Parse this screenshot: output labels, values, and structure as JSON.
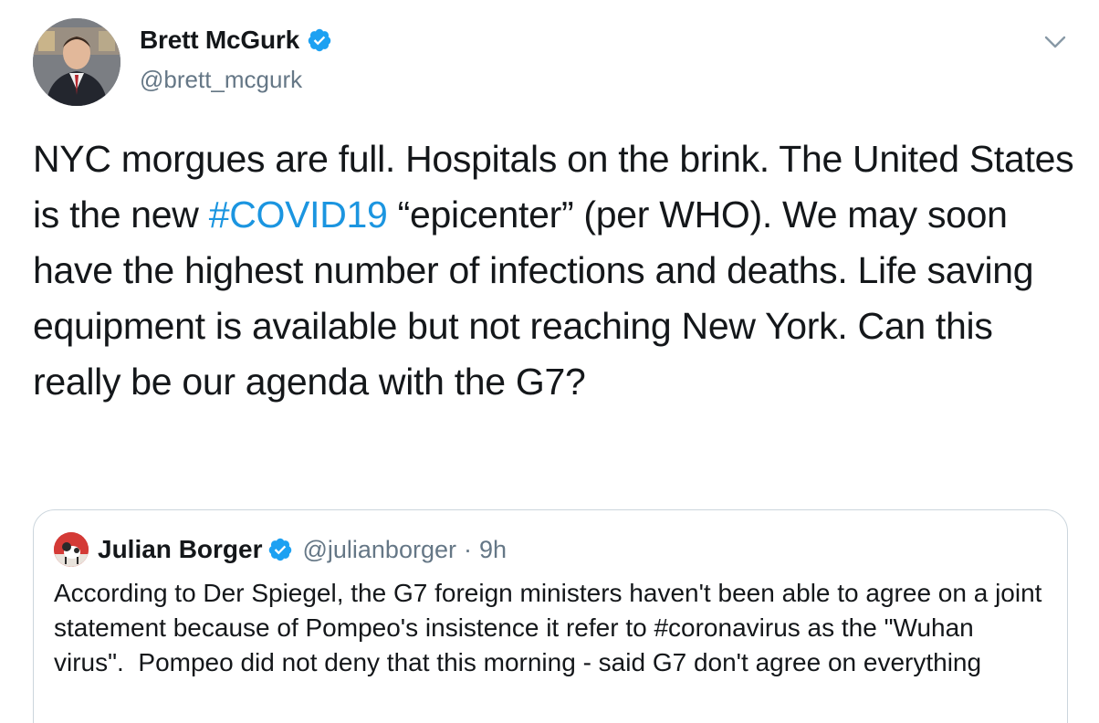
{
  "author": {
    "display_name": "Brett McGurk",
    "handle": "@brett_mcgurk",
    "verified": true
  },
  "tweet": {
    "text_before_hashtag": "NYC morgues are full. Hospitals on the brink. The United States is the new ",
    "hashtag": "#COVID19",
    "text_after_hashtag": " “epicenter” (per WHO). We may soon have the highest number of infections and deaths. Life saving equipment is available but not reaching New York. Can this really be our agenda with the G7?"
  },
  "quoted_tweet": {
    "display_name": "Julian Borger",
    "handle": "@julianborger",
    "separator": "·",
    "time": "9h",
    "verified": true,
    "text": "According to Der Spiegel, the G7 foreign ministers haven't been able to agree on a joint statement because of Pompeo's insistence it refer to #coronavirus as the \"Wuhan virus\".  Pompeo did not deny that this morning - said G7 don't agree on everything"
  },
  "icons": {
    "verified": "verified-badge-icon",
    "menu": "chevron-down-icon"
  },
  "colors": {
    "link": "#1b95e0",
    "verified": "#1da1f2",
    "secondary_text": "#657786",
    "border": "#ccd6dd"
  }
}
